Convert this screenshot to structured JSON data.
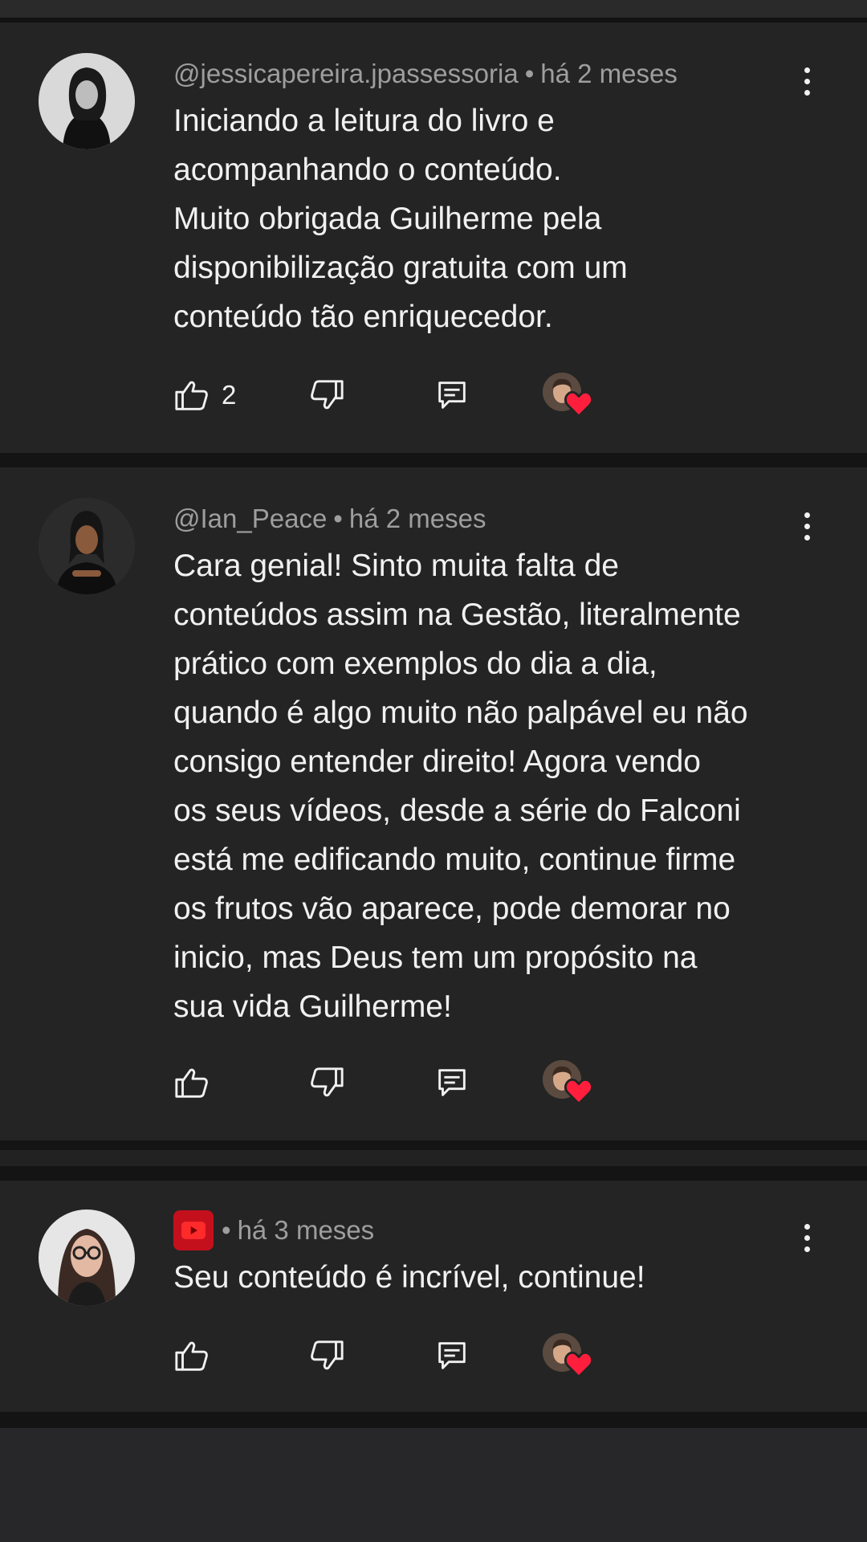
{
  "comments": [
    {
      "author": "@jessicapereira.jpassessoria",
      "time": "há 2 meses",
      "text": "Iniciando a leitura do livro e\nacompanhando o conteúdo.\nMuito obrigada Guilherme pela\ndisponibilização gratuita com um\nconteúdo tão enriquecedor.",
      "likes": "2"
    },
    {
      "author": "@Ian_Peace",
      "time": "há 2 meses",
      "text": "Cara genial! Sinto muita falta de\nconteúdos assim na Gestão, literalmente\nprático com exemplos do dia a dia,\nquando é algo muito não palpável eu não\nconsigo entender direito! Agora vendo\nos seus vídeos, desde a série do Falconi\nestá me edificando muito, continue firme\nos frutos vão aparece, pode demorar no\ninicio, mas Deus tem um propósito na\nsua vida Guilherme!",
      "likes": ""
    },
    {
      "author": "",
      "time": "há 3 meses",
      "text": "Seu conteúdo é incrível, continue!",
      "likes": ""
    }
  ],
  "separator": "•",
  "icons": {
    "like": "thumb-up-icon",
    "dislike": "thumb-down-icon",
    "reply": "reply-comment-icon",
    "creator_heart": "creator-heart-icon",
    "more": "more-vertical-icon",
    "youtube": "youtube-badge-icon"
  },
  "colors": {
    "background": "#242424",
    "text": "#f1f1f1",
    "meta": "#9e9e9e",
    "heart": "#ff1f3d",
    "youtube_red": "#c4101d"
  }
}
